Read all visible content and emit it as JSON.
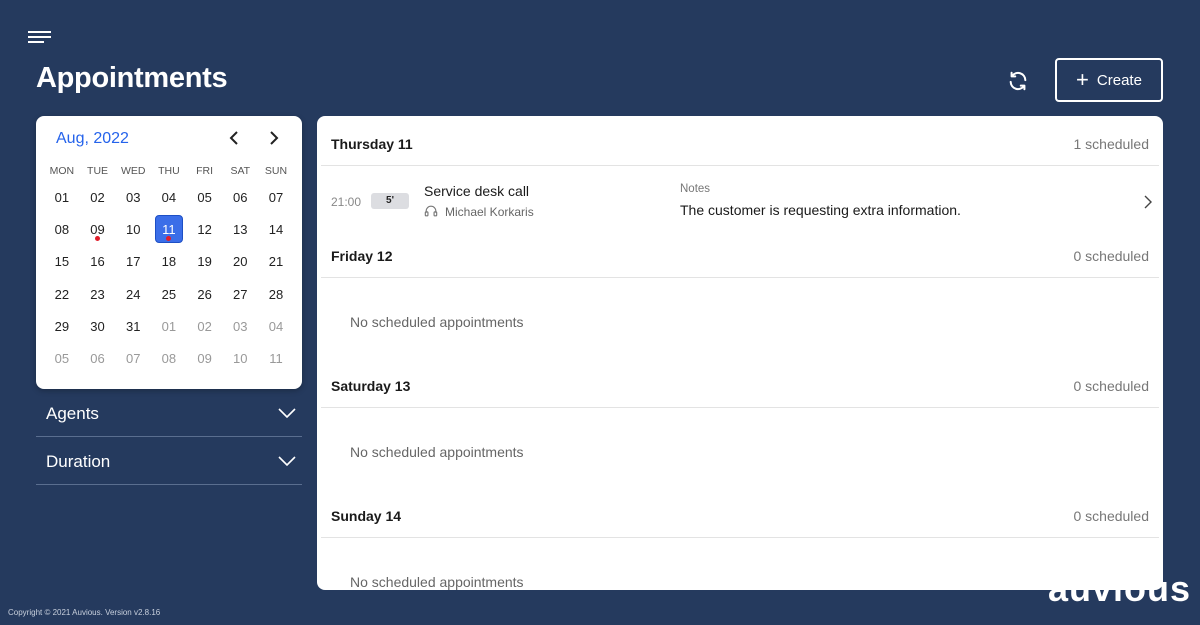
{
  "header": {
    "title": "Appointments",
    "create_label": "Create"
  },
  "calendar": {
    "month_label": "Aug, 2022",
    "weekdays": [
      "MON",
      "TUE",
      "WED",
      "THU",
      "FRI",
      "SAT",
      "SUN"
    ],
    "weeks": [
      [
        "01",
        "02",
        "03",
        "04",
        "05",
        "06",
        "07"
      ],
      [
        "08",
        "09",
        "10",
        "11",
        "12",
        "13",
        "14"
      ],
      [
        "15",
        "16",
        "17",
        "18",
        "19",
        "20",
        "21"
      ],
      [
        "22",
        "23",
        "24",
        "25",
        "26",
        "27",
        "28"
      ],
      [
        "29",
        "30",
        "31",
        "01",
        "02",
        "03",
        "04"
      ],
      [
        "05",
        "06",
        "07",
        "08",
        "09",
        "10",
        "11"
      ]
    ],
    "selected_day": "11",
    "days_with_appointments": [
      "09",
      "11"
    ],
    "accent_color": "#3b6ee8",
    "marker_color": "#e11d2a"
  },
  "filters": [
    {
      "label": "Agents"
    },
    {
      "label": "Duration"
    }
  ],
  "days": [
    {
      "title": "Thursday 11",
      "count": "1 scheduled",
      "appointments": [
        {
          "time": "21:00",
          "duration": "5'",
          "title": "Service desk call",
          "agent": "Michael Korkaris",
          "notes_label": "Notes",
          "notes": "The customer is requesting extra information."
        }
      ]
    },
    {
      "title": "Friday 12",
      "count": "0 scheduled",
      "empty": "No scheduled appointments"
    },
    {
      "title": "Saturday 13",
      "count": "0 scheduled",
      "empty": "No scheduled appointments"
    },
    {
      "title": "Sunday 14",
      "count": "0 scheduled",
      "empty": "No scheduled appointments"
    }
  ],
  "footer": {
    "copyright": "Copyright © 2021 Auvious. Version v2.8.16",
    "brand": "auvious"
  }
}
